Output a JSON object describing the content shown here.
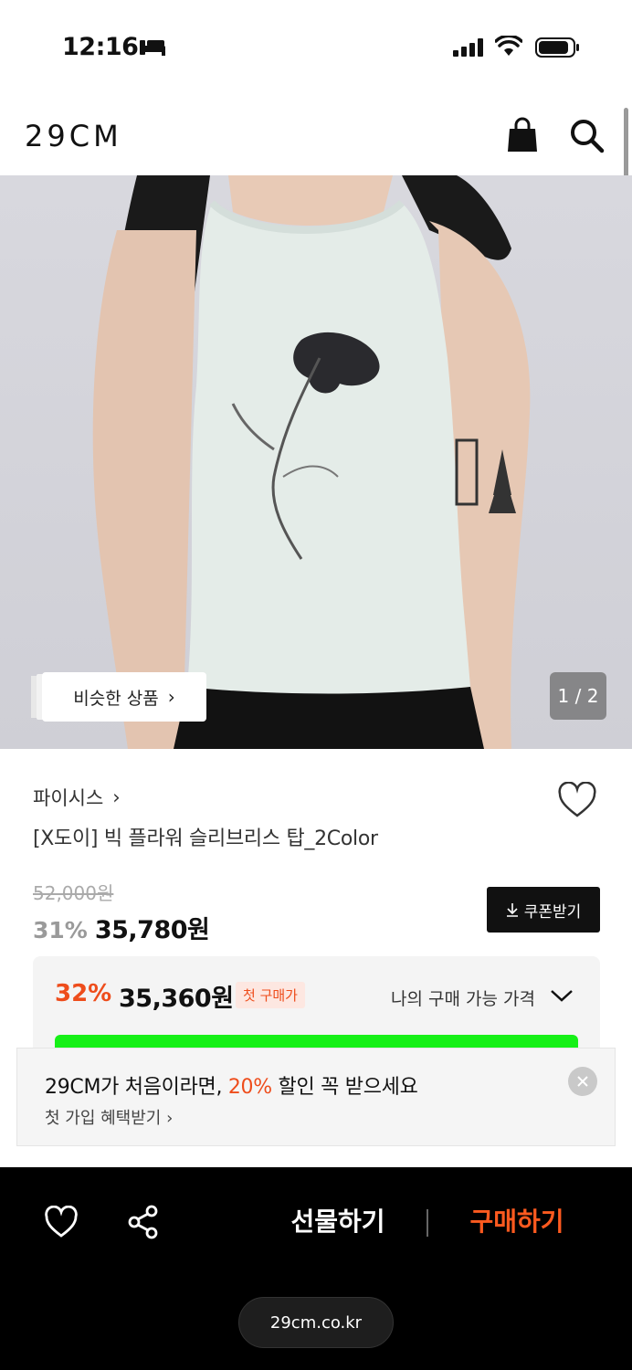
{
  "status_bar": {
    "time": "12:16"
  },
  "header": {
    "logo": "29CM"
  },
  "hero": {
    "similar_label": "비슷한 상품",
    "similar_chevron": "›",
    "image_counter": "1 / 2",
    "image_description_icon": "product-photo"
  },
  "product": {
    "brand": "파이시스",
    "brand_chevron": "›",
    "name": "[X도이] 빅 플라워 슬리브리스 탑_2Color",
    "original_price": "52,000원",
    "discount_pct": "31%",
    "price": "35,780원",
    "coupon_label": "쿠폰받기"
  },
  "my_price": {
    "pct": "32%",
    "price": "35,360원",
    "badge": "첫 구매가",
    "label": "나의 구매 가능 가격"
  },
  "banner": {
    "title_pre": "29CM가 처음이라면, ",
    "title_highlight": "20%",
    "title_post": " 할인 꼭 받으세요",
    "subtitle": "첫 가입 혜택받기 ›"
  },
  "bottom_bar": {
    "gift_label": "선물하기",
    "buy_label": "구매하기",
    "url": "29cm.co.kr"
  },
  "colors": {
    "accent": "#ee4d1c",
    "buy": "#ff5a1f",
    "green_bar": "#16f017"
  }
}
